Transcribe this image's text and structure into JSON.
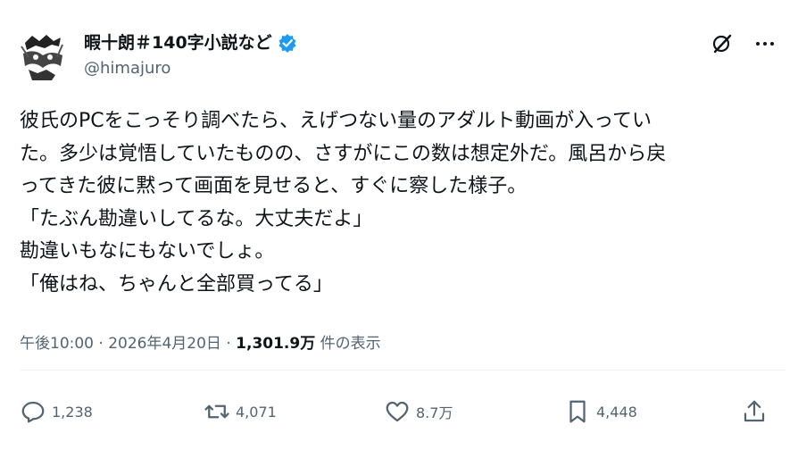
{
  "author": {
    "display_name": "暇十朗＃140字小説など",
    "handle": "@himajuro",
    "verified": true,
    "verified_color": "#1d9bf0"
  },
  "header_icons": [
    "grok-icon",
    "more-icon"
  ],
  "tweet": {
    "text": "彼氏のPCをこっそり調べたら、えげつない量のアダルト動画が入ってい\nた。多少は覚悟していたものの、さすがにこの数は想定外だ。風呂から戻\nってきた彼に黙って画面を見せると、すぐに察した様子。\n「たぶん勘違いしてるな。大丈夫だよ」\n勘違いもなにもないでしょ。\n「俺はね、ちゃんと全部買ってる」",
    "time": "午後10:00",
    "date": "2026年4月20日",
    "views": "1,301.9万",
    "views_suffix": "件の表示"
  },
  "actions": {
    "replies": "1,238",
    "reposts": "4,071",
    "likes": "8.7万",
    "bookmarks": "4,448"
  },
  "colors": {
    "text": "#0f1419",
    "secondary": "#536471",
    "divider": "#eff3f4",
    "accent": "#1d9bf0"
  }
}
